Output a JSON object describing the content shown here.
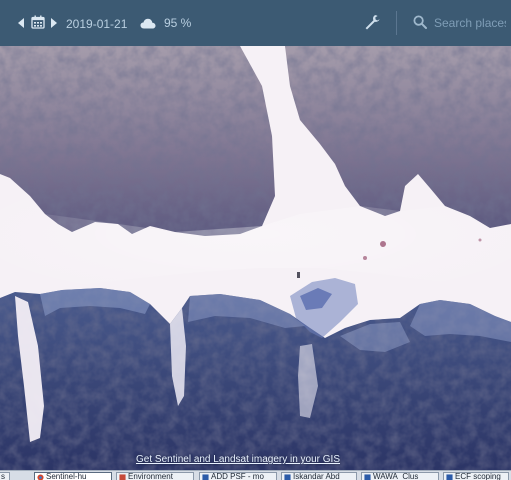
{
  "toolbar": {
    "date": "2019-01-21",
    "cloud_coverage": "95 %",
    "search_placeholder": "Search places"
  },
  "map": {
    "link_text": "Get Sentinel and Landsat imagery in your GIS"
  },
  "taskbar": {
    "items": [
      {
        "label": "s",
        "icon": "folder-icon"
      },
      {
        "label": "Sentinel-hu",
        "icon": "browser-icon"
      },
      {
        "label": "Environment",
        "icon": "app-icon"
      },
      {
        "label": "ADD PSF - mo",
        "icon": "word-icon"
      },
      {
        "label": "Iskandar Abd",
        "icon": "word-icon"
      },
      {
        "label": "WAWA_Clus",
        "icon": "word-icon"
      },
      {
        "label": "ECF scoping",
        "icon": "word-icon"
      }
    ]
  },
  "colors": {
    "toolbar_bg": "#3c5a73",
    "taskbar_bg": "#d7dde6",
    "water_dark": "#2f3a6a",
    "ice_white": "#f7f3f7"
  }
}
